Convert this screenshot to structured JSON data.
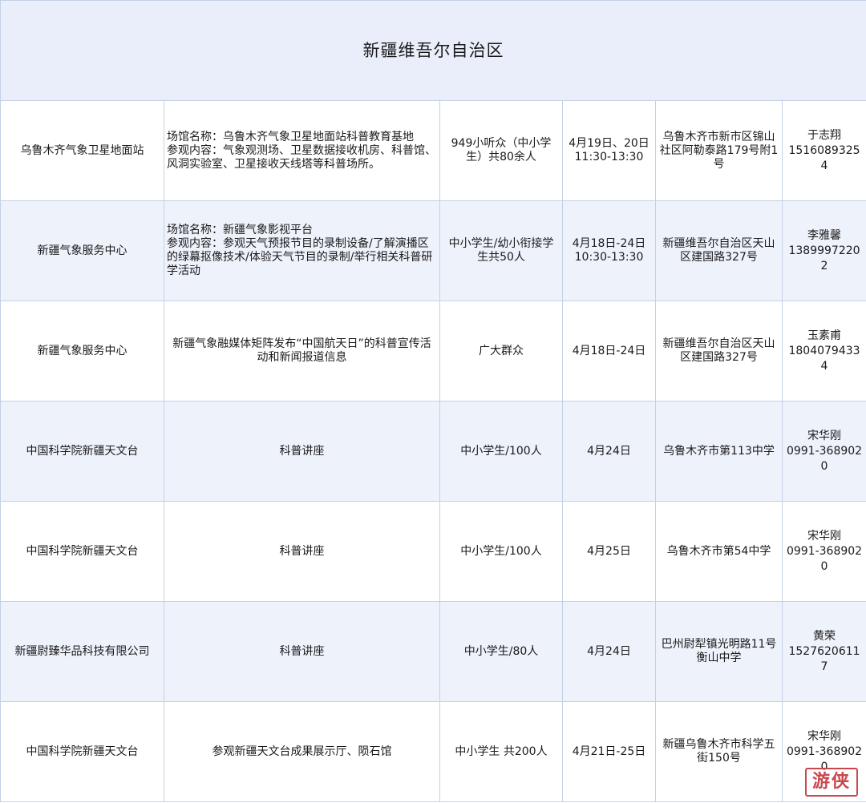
{
  "title": "新疆维吾尔自治区",
  "rows": [
    {
      "org": "乌鲁木齐气象卫星地面站",
      "content": [
        "场馆名称：乌鲁木齐气象卫星地面站科普教育基地",
        "参观内容：气象观测场、卫星数据接收机房、科普馆、风洞实验室、卫星接收天线塔等科普场所。"
      ],
      "audience": "949小听众（中小学生）共80余人",
      "time": [
        "4月19日、20日",
        "11:30-13:30"
      ],
      "place": "乌鲁木齐市新市区锦山社区阿勒泰路179号附1号",
      "contact_name": "于志翔",
      "contact_phone": "15160893254"
    },
    {
      "org": "新疆气象服务中心",
      "content": [
        "场馆名称：新疆气象影视平台",
        "参观内容：参观天气预报节目的录制设备/了解演播区的绿幕抠像技术/体验天气节目的录制/举行相关科普研学活动"
      ],
      "audience": "中小学生/幼小衔接学生共50人",
      "time": [
        "4月18日-24日",
        "10:30-13:30"
      ],
      "place": "新疆维吾尔自治区天山区建国路327号",
      "contact_name": "李雅馨",
      "contact_phone": "13899972202"
    },
    {
      "org": "新疆气象服务中心",
      "content": [
        "新疆气象融媒体矩阵发布“中国航天日”的科普宣传活动和新闻报道信息"
      ],
      "audience": "广大群众",
      "time": [
        "4月18日-24日"
      ],
      "place": "新疆维吾尔自治区天山区建国路327号",
      "contact_name": "玉素甫",
      "contact_phone": "18040794334"
    },
    {
      "org": "中国科学院新疆天文台",
      "content": [
        "科普讲座"
      ],
      "audience": "中小学生/100人",
      "time": [
        "4月24日"
      ],
      "place": "乌鲁木齐市第113中学",
      "contact_name": "宋华刚",
      "contact_phone": "0991-3689020"
    },
    {
      "org": "中国科学院新疆天文台",
      "content": [
        "科普讲座"
      ],
      "audience": "中小学生/100人",
      "time": [
        "4月25日"
      ],
      "place": "乌鲁木齐市第54中学",
      "contact_name": "宋华刚",
      "contact_phone": "0991-3689020"
    },
    {
      "org": "新疆尉臻华品科技有限公司",
      "content": [
        "科普讲座"
      ],
      "audience": "中小学生/80人",
      "time": [
        "4月24日"
      ],
      "place": "巴州尉犁镇光明路11号衡山中学",
      "contact_name": "黄荣",
      "contact_phone": "15276206117"
    },
    {
      "org": "中国科学院新疆天文台",
      "content": [
        "参观新疆天文台成果展示厅、陨石馆"
      ],
      "audience": "中小学生 共200人",
      "time": [
        "4月21日-25日"
      ],
      "place": "新疆乌鲁木齐市科学五街150号",
      "contact_name": "宋华刚",
      "contact_phone": "0991-3689020"
    }
  ],
  "watermark": "游侠"
}
